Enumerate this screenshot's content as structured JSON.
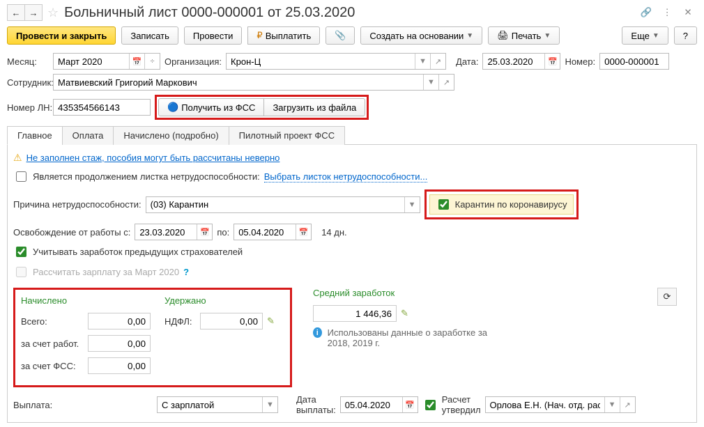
{
  "header": {
    "title": "Больничный лист 0000-000001 от 25.03.2020"
  },
  "toolbar": {
    "submit_close": "Провести и закрыть",
    "save": "Записать",
    "submit": "Провести",
    "pay": "Выплатить",
    "create_based": "Создать на основании",
    "print": "Печать",
    "more": "Еще",
    "help": "?"
  },
  "fields": {
    "month_label": "Месяц:",
    "month_value": "Март 2020",
    "org_label": "Организация:",
    "org_value": "Крон-Ц",
    "date_label": "Дата:",
    "date_value": "25.03.2020",
    "number_label": "Номер:",
    "number_value": "0000-000001",
    "employee_label": "Сотрудник:",
    "employee_value": "Матвиевский Григорий Маркович",
    "ln_label": "Номер ЛН:",
    "ln_value": "435354566143",
    "get_fss": "Получить из ФСС",
    "load_file": "Загрузить из файла"
  },
  "tabs": {
    "main": "Главное",
    "payment": "Оплата",
    "accrued": "Начислено (подробно)",
    "pilot": "Пилотный проект ФСС"
  },
  "main_tab": {
    "warning": "Не заполнен стаж, пособия могут быть рассчитаны неверно",
    "continuation": "Является продолжением листка нетрудоспособности:",
    "select_sheet": "Выбрать листок нетрудоспособности...",
    "reason_label": "Причина нетрудоспособности:",
    "reason_value": "(03) Карантин",
    "corona": "Карантин по коронавирусу",
    "absence_label": "Освобождение от работы с:",
    "date_from": "23.03.2020",
    "to_label": "по:",
    "date_to": "05.04.2020",
    "days": "14 дн.",
    "prev_insurers": "Учитывать заработок предыдущих страхователей",
    "recalc_salary": "Рассчитать зарплату за Март 2020",
    "help_q": "?"
  },
  "calc": {
    "accrued_title": "Начислено",
    "withheld_title": "Удержано",
    "total_label": "Всего:",
    "total_value": "0,00",
    "employer_label": "за счет работ.",
    "employer_value": "0,00",
    "fss_label": "за счет ФСС:",
    "fss_value": "0,00",
    "ndfl_label": "НДФЛ:",
    "ndfl_value": "0,00",
    "avg_title": "Средний заработок",
    "avg_value": "1 446,36",
    "info_text": "Использованы данные о заработке за 2018,   2019 г."
  },
  "bottom": {
    "payout_label": "Выплата:",
    "payout_value": "С зарплатой",
    "payout_date_label": "Дата выплаты:",
    "payout_date_value": "05.04.2020",
    "calc_approved": "Расчет утвердил",
    "approver": "Орлова Е.Н. (Нач. отд. расчет"
  }
}
